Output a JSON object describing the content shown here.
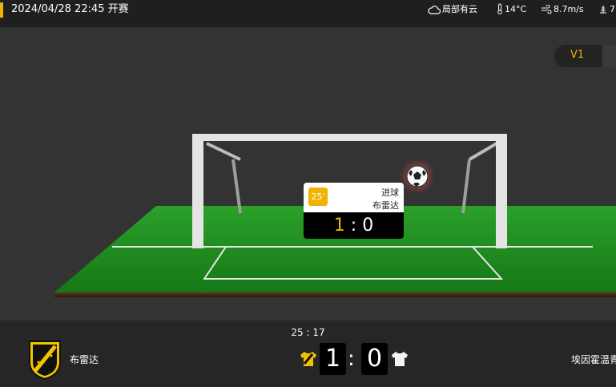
{
  "header": {
    "datetime": "2024/04/28 22:45",
    "status": "开赛",
    "weather": "局部有云",
    "temperature": "14°C",
    "wind": "8.7m/s",
    "extra": "7"
  },
  "version": {
    "label": "V1"
  },
  "event": {
    "minute": "25'",
    "type": "进球",
    "team": "布雷达",
    "home_score": "1",
    "away_score": "0"
  },
  "match": {
    "clock": "25 : 17",
    "home_team": "布雷达",
    "away_team": "埃因霍温青",
    "home_score": "1",
    "away_score": "0",
    "separator": ":"
  },
  "colors": {
    "accent": "#f0b400",
    "pitch": "#1f8a1f",
    "background": "#333333"
  }
}
